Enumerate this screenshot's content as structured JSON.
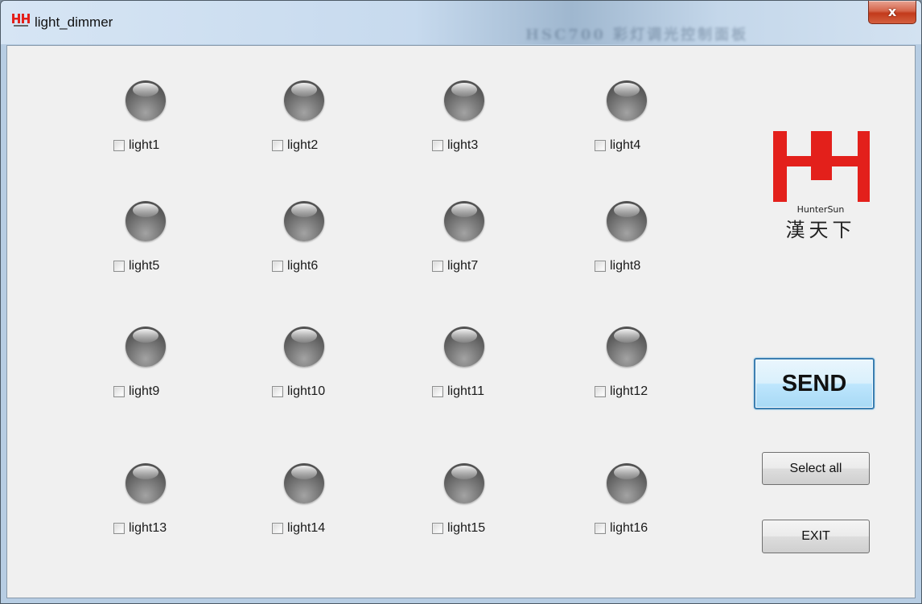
{
  "window": {
    "title": "light_dimmer",
    "faded_background_title": "HSC700 彩灯调光控制面板",
    "close_glyph": "x",
    "icon": "hunter-sun-app-icon"
  },
  "lights": [
    {
      "label": "light1",
      "checked": false
    },
    {
      "label": "light2",
      "checked": false
    },
    {
      "label": "light3",
      "checked": false
    },
    {
      "label": "light4",
      "checked": false
    },
    {
      "label": "light5",
      "checked": false
    },
    {
      "label": "light6",
      "checked": false
    },
    {
      "label": "light7",
      "checked": false
    },
    {
      "label": "light8",
      "checked": false
    },
    {
      "label": "light9",
      "checked": false
    },
    {
      "label": "light10",
      "checked": false
    },
    {
      "label": "light11",
      "checked": false
    },
    {
      "label": "light12",
      "checked": false
    },
    {
      "label": "light13",
      "checked": false
    },
    {
      "label": "light14",
      "checked": false
    },
    {
      "label": "light15",
      "checked": false
    },
    {
      "label": "light16",
      "checked": false
    }
  ],
  "logo": {
    "brand_text": "HunterSun",
    "chinese_text": "漢天下",
    "color": "#e3201b"
  },
  "buttons": {
    "send": "SEND",
    "select_all": "Select all",
    "exit": "EXIT"
  },
  "colors": {
    "accent_send": "#3c7fb1",
    "bulb_off": "#6b6b6b",
    "panel_background": "#f0f0f0"
  }
}
